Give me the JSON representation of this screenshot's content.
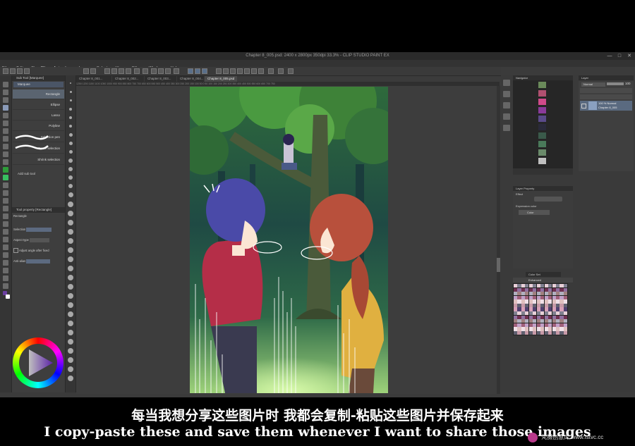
{
  "window": {
    "title": "Chapter 8_005.psd: 2400 x 2800px 350dpi 33.3% - CLIP STUDIO PAINT EX",
    "controls": [
      "—",
      "□",
      "✕"
    ]
  },
  "menu": [
    "File",
    "Edit",
    "Story(P)",
    "Animation",
    "Layer",
    "Select",
    "View",
    "Filter",
    "Window",
    "Help"
  ],
  "tabs": [
    "Chapter 8_001...",
    "Chapter 8_002...",
    "Chapter 8_003...",
    "Chapter 8_004...",
    "Chapter 8_005.psd"
  ],
  "active_tab": 4,
  "subtool_panel": {
    "header": "Sub Tool [Marquee]",
    "group": "Marquee",
    "items": [
      "Rectangle",
      "Ellipse",
      "Lasso",
      "Polyline",
      "Selection pen",
      "Erase selection",
      "Shrink selection"
    ],
    "selected": 0,
    "add_label": "Add sub tool"
  },
  "tool_property": {
    "header": "Tool property [Rectangle]",
    "name": "Rectangle",
    "rows": [
      {
        "label": "Selection",
        "value": ""
      },
      {
        "label": "Aspect type",
        "value": ""
      },
      {
        "label": "Adjust angle after fixed",
        "value": ""
      },
      {
        "label": "Anti-alias",
        "value": ""
      }
    ]
  },
  "ruler": "1250 1200 1150 1100 1050 1000 950 900 850 800 750 700 650 600 550 500 450 400 350 300 250 200 150 100 50 0 50 100 150 200 250 300 350 400 450 500 550 600 650 700 750",
  "navigator": {
    "header": "Navigator"
  },
  "layer_panel": {
    "header": "Layer",
    "blend_mode": "Normal",
    "opacity": "100",
    "layer_info": "100 % Normal",
    "layer_name": "Chapter 8_005"
  },
  "layer_property": {
    "header": "Layer Property",
    "effect": "Effect",
    "expression_color_label": "Expression color",
    "color_value": "Color"
  },
  "color_set": {
    "header": "Color Set",
    "name": "Enhanced"
  },
  "subtitles": {
    "chinese": "每当我想分享这些图片时 我都会复制-粘贴这些图片并保存起来",
    "english": "I copy-paste these and save them whenever I want to share those images"
  },
  "watermark": "梵摄创意库 www.fstvc.cc",
  "colors": {
    "accent": "#5a6470",
    "main_color": "#6b3fa0",
    "sub_color": "#ffffff"
  }
}
